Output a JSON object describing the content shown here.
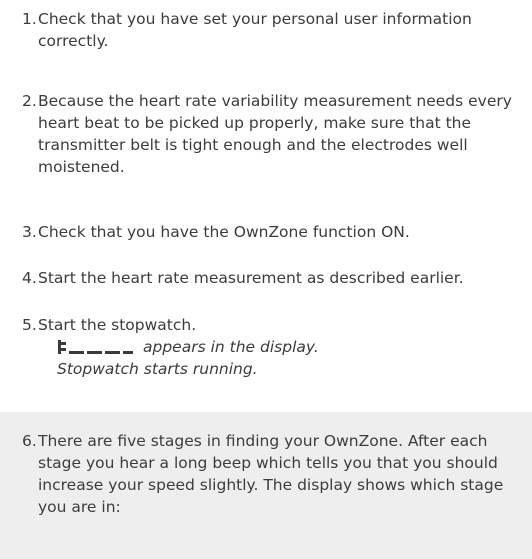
{
  "steps": [
    {
      "number": "1.",
      "text": "Check that you have set your personal user information correctly."
    },
    {
      "number": "2.",
      "text": "Because the heart rate variability measurement needs every heart beat to be picked up properly, make sure that the transmitter belt is tight enough and the electrodes well moistened."
    },
    {
      "number": "3.",
      "text": "Check that you have the OwnZone function ON."
    },
    {
      "number": "4.",
      "text": "Start the heart rate measurement as described earlier."
    },
    {
      "number": "5.",
      "text": "Start the stopwatch."
    },
    {
      "number": "6.",
      "text": "There are five stages in finding your OwnZone. After each stage you hear a long beep which tells you that you should increase your speed slightly. The display shows which stage you are in:"
    }
  ],
  "step5_details": {
    "display_text": "appears in the display.",
    "status_text": "Stopwatch starts running."
  },
  "colors": {
    "text": "#3c3c3c",
    "panel_background": "#eeeeee"
  },
  "icons": {
    "display_indicator": "ownzone-stage-display-icon"
  }
}
